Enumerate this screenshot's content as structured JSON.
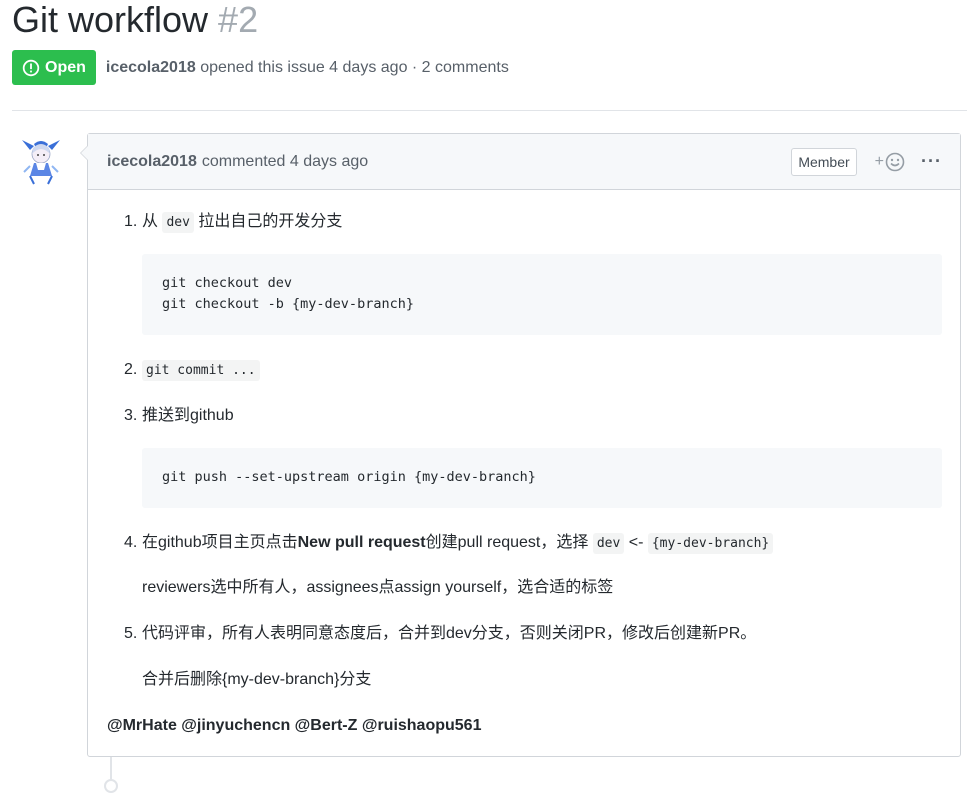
{
  "issue": {
    "title": "Git workflow",
    "number": "#2",
    "state": "Open",
    "author": "icecola2018",
    "opened_text": "opened this issue 4 days ago · 2 comments"
  },
  "comment": {
    "author": "icecola2018",
    "time_text": "commented 4 days ago",
    "role_label": "Member",
    "reaction_plus": "+",
    "more_label": "···",
    "body": {
      "item1": {
        "num": "1.",
        "pre": "从 ",
        "code": "dev",
        "post": " 拉出自己的开发分支"
      },
      "code1": [
        "git checkout dev",
        "git checkout -b {my-dev-branch}"
      ],
      "item2": {
        "num": "2.",
        "code": "git commit ..."
      },
      "item3": {
        "num": "3.",
        "text": "推送到github"
      },
      "code2": [
        "git push --set-upstream origin {my-dev-branch}"
      ],
      "item4": {
        "num": "4.",
        "pre": "在github项目主页点击",
        "bold": "New pull request",
        "mid": "创建pull request，选择 ",
        "code_a": "dev",
        "arrow": " <- ",
        "code_b": "{my-dev-branch}",
        "line2": "reviewers选中所有人，assignees点assign yourself，选合适的标签"
      },
      "item5": {
        "num": "5.",
        "text": "代码评审，所有人表明同意态度后，合并到dev分支，否则关闭PR，修改后创建新PR。",
        "line2": "合并后删除{my-dev-branch}分支"
      },
      "mentions": "@MrHate @jinyuchencn @Bert-Z @ruishaopu561"
    }
  }
}
